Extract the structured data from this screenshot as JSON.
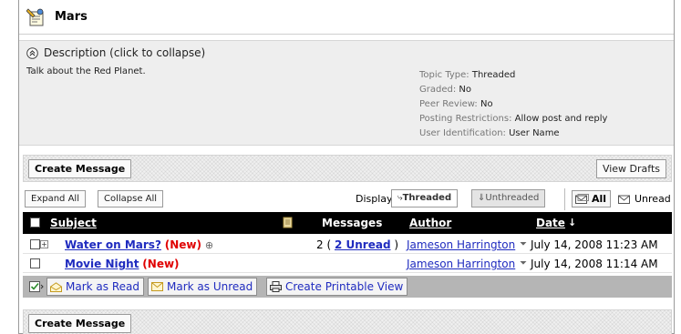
{
  "topic": {
    "title": "Mars"
  },
  "description": {
    "toggle_label": "Description (click to collapse)",
    "text": "Talk about the Red Planet.",
    "meta": [
      {
        "key": "Topic Type:",
        "value": "Threaded"
      },
      {
        "key": "Graded:",
        "value": "No"
      },
      {
        "key": "Peer Review:",
        "value": "No"
      },
      {
        "key": "Posting Restrictions:",
        "value": "Allow post and reply"
      },
      {
        "key": "User Identification:",
        "value": "User Name"
      }
    ]
  },
  "top_actions": {
    "create_message": "Create Message",
    "view_drafts": "View Drafts"
  },
  "toolbar": {
    "expand_all": "Expand All",
    "collapse_all": "Collapse All",
    "display_label": "Display:",
    "threaded": "Threaded",
    "unthreaded": "Unthreaded",
    "filter_all": "All",
    "filter_unread": "Unread"
  },
  "table": {
    "headers": {
      "subject": "Subject",
      "messages": "Messages",
      "author": "Author",
      "date": "Date"
    },
    "rows": [
      {
        "subject": "Water on Mars?",
        "new": "(New)",
        "messages_prefix": "2 (",
        "messages_link": "2 Unread",
        "messages_suffix": ")",
        "author": "Jameson Harrington",
        "date": "July 14, 2008 11:23 AM"
      },
      {
        "subject": "Movie Night",
        "new": "(New)",
        "author": "Jameson Harrington",
        "date": "July 14, 2008 11:14 AM"
      }
    ]
  },
  "row_actions": {
    "mark_read": "Mark as Read",
    "mark_unread": "Mark as Unread",
    "printable": "Create Printable View"
  },
  "bottom_actions": {
    "create_message": "Create Message"
  }
}
